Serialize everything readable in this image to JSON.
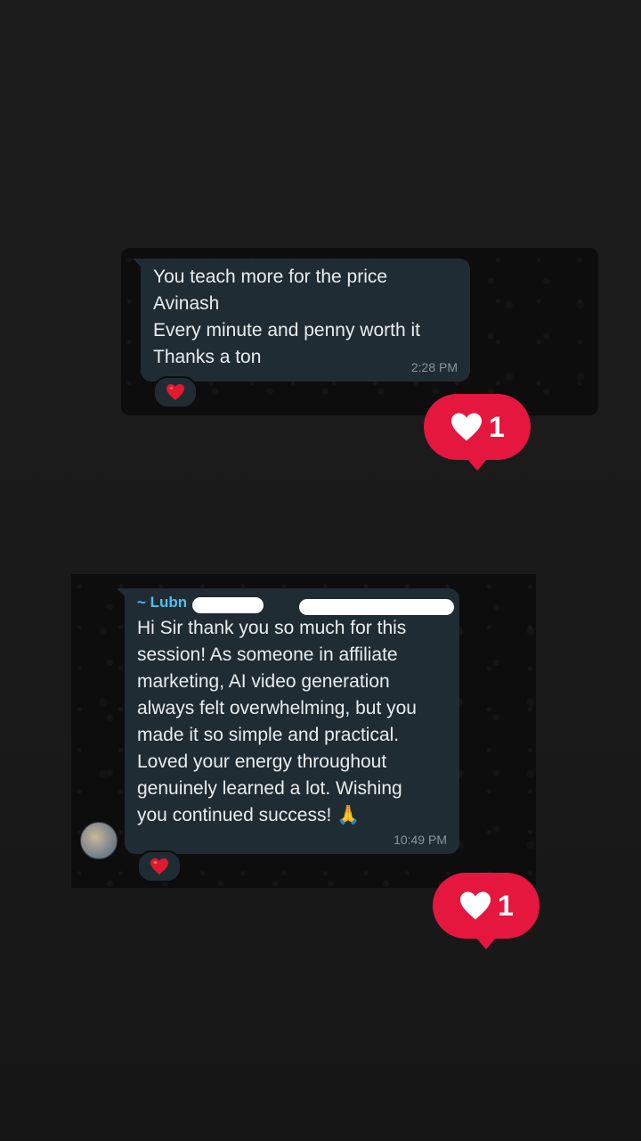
{
  "message1": {
    "text": "You teach more for the price\nAvinash\nEvery minute and penny worth it\nThanks a ton",
    "time": "2:28 PM",
    "reaction_icon": "red-heart-emoji"
  },
  "message2": {
    "sender": "~ Lubn",
    "text": "Hi Sir thank you so much for this\nsession! As someone in affiliate\nmarketing, AI video generation\nalways felt overwhelming, but you\nmade it so simple and practical.\nLoved your energy throughout\ngenuinely learned a lot. Wishing\nyou continued success! 🙏",
    "time": "10:49 PM",
    "reaction_icon": "red-heart-emoji"
  },
  "like_badges": [
    {
      "count": "1",
      "icon": "heart-icon"
    },
    {
      "count": "1",
      "icon": "heart-icon"
    }
  ],
  "colors": {
    "background": "#1a1a1a",
    "bubble": "#202c33",
    "sender_name": "#53bdeb",
    "timestamp": "#8696a0",
    "like_badge": "#e5173f"
  }
}
